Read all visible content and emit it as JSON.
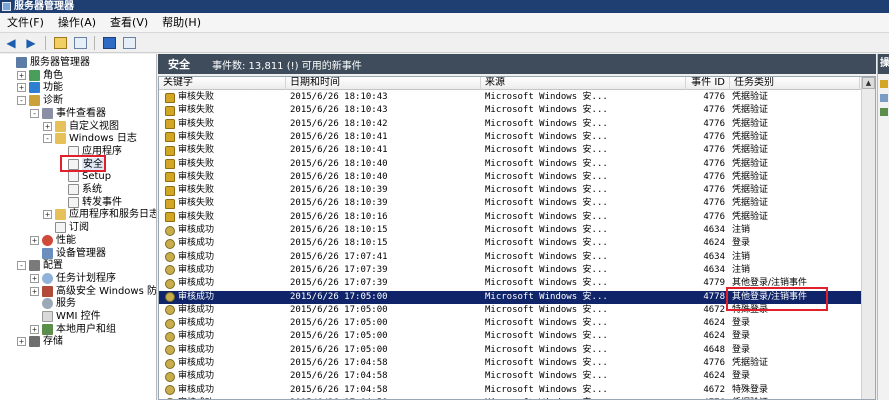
{
  "window": {
    "title": "服务器管理器"
  },
  "menu": [
    "文件(F)",
    "操作(A)",
    "查看(V)",
    "帮助(H)"
  ],
  "toolbar": {
    "icons": [
      "back-icon",
      "forward-icon",
      "up-folder-icon",
      "show-tree-icon",
      "help-icon",
      "properties-icon"
    ]
  },
  "tree": [
    {
      "label": "服务器管理器",
      "level": 0,
      "expander": "",
      "icon": "server"
    },
    {
      "label": "角色",
      "level": 1,
      "expander": "+",
      "icon": "role"
    },
    {
      "label": "功能",
      "level": 1,
      "expander": "+",
      "icon": "feat"
    },
    {
      "label": "诊断",
      "level": 1,
      "expander": "-",
      "icon": "diag"
    },
    {
      "label": "事件查看器",
      "level": 2,
      "expander": "-",
      "icon": "event"
    },
    {
      "label": "自定义视图",
      "level": 3,
      "expander": "+",
      "icon": "folder"
    },
    {
      "label": "Windows 日志",
      "level": 3,
      "expander": "-",
      "icon": "folder"
    },
    {
      "label": "应用程序",
      "level": 4,
      "expander": "",
      "icon": "log"
    },
    {
      "label": "安全",
      "level": 4,
      "expander": "",
      "icon": "log",
      "selected": true
    },
    {
      "label": "Setup",
      "level": 4,
      "expander": "",
      "icon": "log"
    },
    {
      "label": "系统",
      "level": 4,
      "expander": "",
      "icon": "log"
    },
    {
      "label": "转发事件",
      "level": 4,
      "expander": "",
      "icon": "log"
    },
    {
      "label": "应用程序和服务日志",
      "level": 3,
      "expander": "+",
      "icon": "folder"
    },
    {
      "label": "订阅",
      "level": 3,
      "expander": "",
      "icon": "log"
    },
    {
      "label": "性能",
      "level": 2,
      "expander": "+",
      "icon": "perf"
    },
    {
      "label": "设备管理器",
      "level": 2,
      "expander": "",
      "icon": "dev"
    },
    {
      "label": "配置",
      "level": 1,
      "expander": "-",
      "icon": "conf"
    },
    {
      "label": "任务计划程序",
      "level": 2,
      "expander": "+",
      "icon": "task"
    },
    {
      "label": "高级安全 Windows 防火墙",
      "level": 2,
      "expander": "+",
      "icon": "fw"
    },
    {
      "label": "服务",
      "level": 2,
      "expander": "",
      "icon": "svc"
    },
    {
      "label": "WMI 控件",
      "level": 2,
      "expander": "",
      "icon": "wmi"
    },
    {
      "label": "本地用户和组",
      "level": 2,
      "expander": "+",
      "icon": "user"
    },
    {
      "label": "存储",
      "level": 1,
      "expander": "+",
      "icon": "store"
    }
  ],
  "panel": {
    "title": "安全",
    "info": "事件数: 13,811 (!) 可用的新事件"
  },
  "columns": [
    "关键字",
    "日期和时间",
    "来源",
    "事件 ID",
    "任务类别"
  ],
  "rows": [
    {
      "kw": "审核失败",
      "dt": "2015/6/26 18:10:43",
      "src": "Microsoft Windows 安...",
      "id": "4776",
      "cat": "凭据验证",
      "icon": "lock"
    },
    {
      "kw": "审核失败",
      "dt": "2015/6/26 18:10:43",
      "src": "Microsoft Windows 安...",
      "id": "4776",
      "cat": "凭据验证",
      "icon": "lock"
    },
    {
      "kw": "审核失败",
      "dt": "2015/6/26 18:10:42",
      "src": "Microsoft Windows 安...",
      "id": "4776",
      "cat": "凭据验证",
      "icon": "lock"
    },
    {
      "kw": "审核失败",
      "dt": "2015/6/26 18:10:41",
      "src": "Microsoft Windows 安...",
      "id": "4776",
      "cat": "凭据验证",
      "icon": "lock"
    },
    {
      "kw": "审核失败",
      "dt": "2015/6/26 18:10:41",
      "src": "Microsoft Windows 安...",
      "id": "4776",
      "cat": "凭据验证",
      "icon": "lock"
    },
    {
      "kw": "审核失败",
      "dt": "2015/6/26 18:10:40",
      "src": "Microsoft Windows 安...",
      "id": "4776",
      "cat": "凭据验证",
      "icon": "lock"
    },
    {
      "kw": "审核失败",
      "dt": "2015/6/26 18:10:40",
      "src": "Microsoft Windows 安...",
      "id": "4776",
      "cat": "凭据验证",
      "icon": "lock"
    },
    {
      "kw": "审核失败",
      "dt": "2015/6/26 18:10:39",
      "src": "Microsoft Windows 安...",
      "id": "4776",
      "cat": "凭据验证",
      "icon": "lock"
    },
    {
      "kw": "审核失败",
      "dt": "2015/6/26 18:10:39",
      "src": "Microsoft Windows 安...",
      "id": "4776",
      "cat": "凭据验证",
      "icon": "lock"
    },
    {
      "kw": "审核失败",
      "dt": "2015/6/26 18:10:16",
      "src": "Microsoft Windows 安...",
      "id": "4776",
      "cat": "凭据验证",
      "icon": "lock"
    },
    {
      "kw": "审核成功",
      "dt": "2015/6/26 18:10:15",
      "src": "Microsoft Windows 安...",
      "id": "4634",
      "cat": "注销",
      "icon": "key"
    },
    {
      "kw": "审核成功",
      "dt": "2015/6/26 18:10:15",
      "src": "Microsoft Windows 安...",
      "id": "4624",
      "cat": "登录",
      "icon": "key"
    },
    {
      "kw": "审核成功",
      "dt": "2015/6/26 17:07:41",
      "src": "Microsoft Windows 安...",
      "id": "4634",
      "cat": "注销",
      "icon": "key"
    },
    {
      "kw": "审核成功",
      "dt": "2015/6/26 17:07:39",
      "src": "Microsoft Windows 安...",
      "id": "4634",
      "cat": "注销",
      "icon": "key"
    },
    {
      "kw": "审核成功",
      "dt": "2015/6/26 17:07:39",
      "src": "Microsoft Windows 安...",
      "id": "4779",
      "cat": "其他登录/注销事件",
      "icon": "key"
    },
    {
      "kw": "审核成功",
      "dt": "2015/6/26 17:05:00",
      "src": "Microsoft Windows 安...",
      "id": "4778",
      "cat": "其他登录/注销事件",
      "icon": "key",
      "selected": true
    },
    {
      "kw": "审核成功",
      "dt": "2015/6/26 17:05:00",
      "src": "Microsoft Windows 安...",
      "id": "4672",
      "cat": "特殊登录",
      "icon": "key"
    },
    {
      "kw": "审核成功",
      "dt": "2015/6/26 17:05:00",
      "src": "Microsoft Windows 安...",
      "id": "4624",
      "cat": "登录",
      "icon": "key"
    },
    {
      "kw": "审核成功",
      "dt": "2015/6/26 17:05:00",
      "src": "Microsoft Windows 安...",
      "id": "4624",
      "cat": "登录",
      "icon": "key"
    },
    {
      "kw": "审核成功",
      "dt": "2015/6/26 17:05:00",
      "src": "Microsoft Windows 安...",
      "id": "4648",
      "cat": "登录",
      "icon": "key"
    },
    {
      "kw": "审核成功",
      "dt": "2015/6/26 17:04:58",
      "src": "Microsoft Windows 安...",
      "id": "4776",
      "cat": "凭据验证",
      "icon": "key"
    },
    {
      "kw": "审核成功",
      "dt": "2015/6/26 17:04:58",
      "src": "Microsoft Windows 安...",
      "id": "4624",
      "cat": "登录",
      "icon": "key"
    },
    {
      "kw": "审核成功",
      "dt": "2015/6/26 17:04:58",
      "src": "Microsoft Windows 安...",
      "id": "4672",
      "cat": "特殊登录",
      "icon": "key"
    },
    {
      "kw": "审核成功",
      "dt": "2015/6/26 17:04:58",
      "src": "Microsoft Windows 安...",
      "id": "4776",
      "cat": "凭据验证",
      "icon": "key"
    }
  ],
  "actions": {
    "title": "操"
  },
  "colors": {
    "selection": "#10246a",
    "highlight": "#e0212b",
    "header_bar": "#3e4c5c"
  }
}
